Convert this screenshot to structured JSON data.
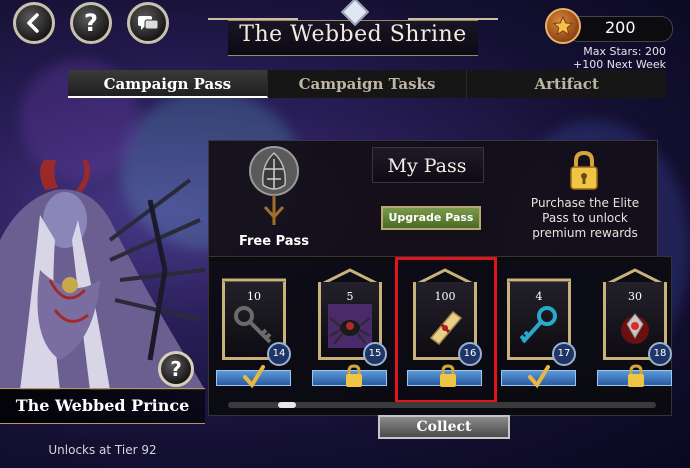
{
  "header": {
    "title": "The Webbed Shrine",
    "stars": "200",
    "max_stars": "Max Stars: 200",
    "next_week": "+100 Next Week"
  },
  "tabs": [
    {
      "label": "Campaign Pass",
      "active": true
    },
    {
      "label": "Campaign Tasks",
      "active": false
    },
    {
      "label": "Artifact",
      "active": false
    }
  ],
  "pass": {
    "heading": "My Pass",
    "free_label": "Free Pass",
    "upgrade_label": "Upgrade Pass",
    "purchase_text": "Purchase the Elite Pass to unlock premium rewards"
  },
  "rewards": [
    {
      "count": "10",
      "tier": "14",
      "item": "key-icon",
      "status": "claimed"
    },
    {
      "count": "5",
      "tier": "15",
      "item": "spider-icon",
      "status": "locked"
    },
    {
      "count": "100",
      "tier": "16",
      "item": "scroll-icon",
      "status": "locked",
      "highlighted": true
    },
    {
      "count": "4",
      "tier": "17",
      "item": "key-icon",
      "status": "claimed"
    },
    {
      "count": "30",
      "tier": "18",
      "item": "gem-icon",
      "status": "locked"
    }
  ],
  "collect_label": "Collect",
  "hero": {
    "name": "The Webbed Prince",
    "unlock": "Unlocks at Tier 92"
  },
  "colors": {
    "accent_gold": "#c7b27a",
    "highlight_red": "#e0141a",
    "tier_blue": "#2a5aa0"
  }
}
